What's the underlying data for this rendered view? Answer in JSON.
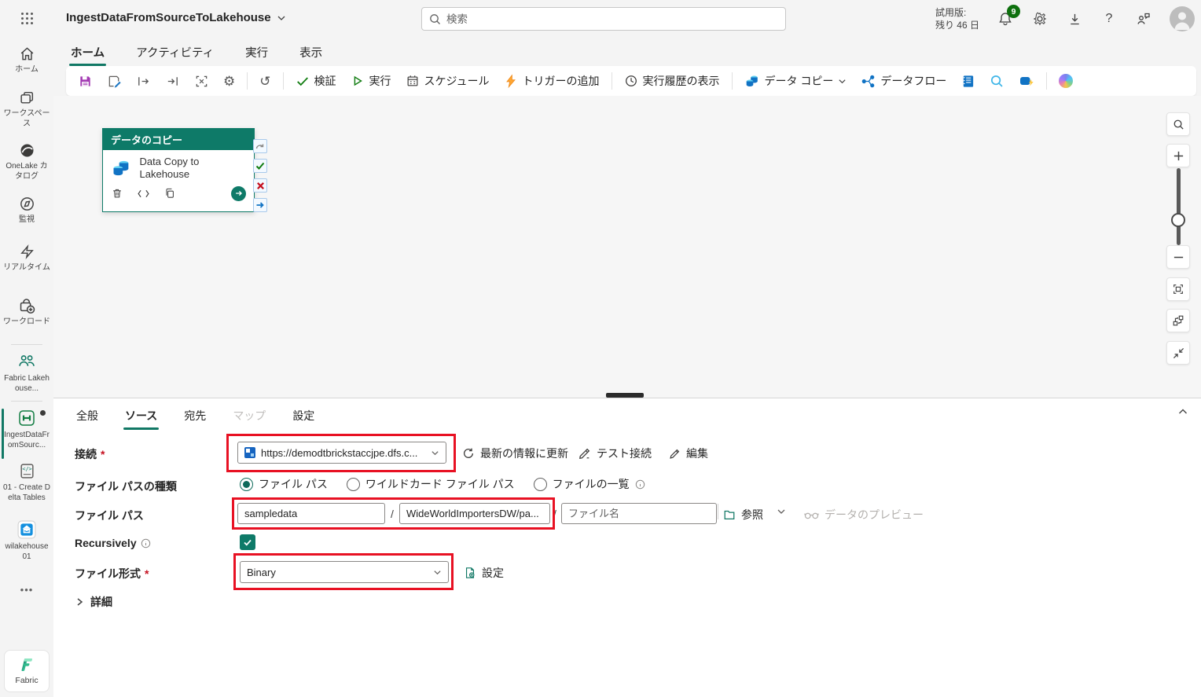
{
  "header": {
    "title": "IngestDataFromSourceToLakehouse",
    "search_placeholder": "検索",
    "trial_line1": "試用版:",
    "trial_line2": "残り 46 日",
    "notification_count": "9",
    "help_glyph": "?"
  },
  "menu_tabs": [
    {
      "label": "ホーム"
    },
    {
      "label": "アクティビティ"
    },
    {
      "label": "実行"
    },
    {
      "label": "表示"
    }
  ],
  "toolbar": {
    "validate": "検証",
    "run": "実行",
    "schedule": "スケジュール",
    "add_trigger": "トリガーの追加",
    "run_history": "実行履歴の表示",
    "data_copy": "データ コピー",
    "dataflow": "データフロー"
  },
  "sidebar": {
    "items": [
      {
        "label": "ホーム"
      },
      {
        "label": "ワークスペース"
      },
      {
        "label": "OneLake カタログ"
      },
      {
        "label": "監視"
      },
      {
        "label": "リアルタイム"
      },
      {
        "label": "ワークロード"
      },
      {
        "label": "Fabric Lakehouse..."
      },
      {
        "label": "IngestDataFromSourc..."
      },
      {
        "label": "01 - Create Delta Tables"
      },
      {
        "label": "wilakehouse 01"
      }
    ],
    "more_glyph": "•••",
    "footer": "Fabric"
  },
  "glyphs": {
    "gear": "⚙",
    "undo": "↺",
    "code": "</>"
  },
  "canvas": {
    "card": {
      "header": "データのコピー",
      "title": "Data Copy to Lakehouse"
    }
  },
  "panel": {
    "tabs": [
      {
        "label": "全般"
      },
      {
        "label": "ソース"
      },
      {
        "label": "宛先"
      },
      {
        "label": "マップ"
      },
      {
        "label": "設定"
      }
    ],
    "connection": {
      "label": "接続",
      "required": "*",
      "value": "https://demodtbrickstaccjpe.dfs.c...",
      "refresh_label": "最新の情報に更新",
      "test_label": "テスト接続",
      "edit_label": "編集"
    },
    "path_type": {
      "label": "ファイル パスの種類",
      "option1": "ファイル パス",
      "option2": "ワイルドカード ファイル パス",
      "option3": "ファイルの一覧"
    },
    "file_path": {
      "label": "ファイル パス",
      "value1": "sampledata",
      "separator": "/",
      "value2": "WideWorldImportersDW/pa...",
      "filename_placeholder": "ファイル名",
      "browse_label": "参照",
      "preview_label": "データのプレビュー"
    },
    "recursively": {
      "label": "Recursively"
    },
    "file_format": {
      "label": "ファイル形式",
      "required": "*",
      "value": "Binary",
      "settings_label": "設定"
    },
    "advanced_label": "詳細"
  }
}
